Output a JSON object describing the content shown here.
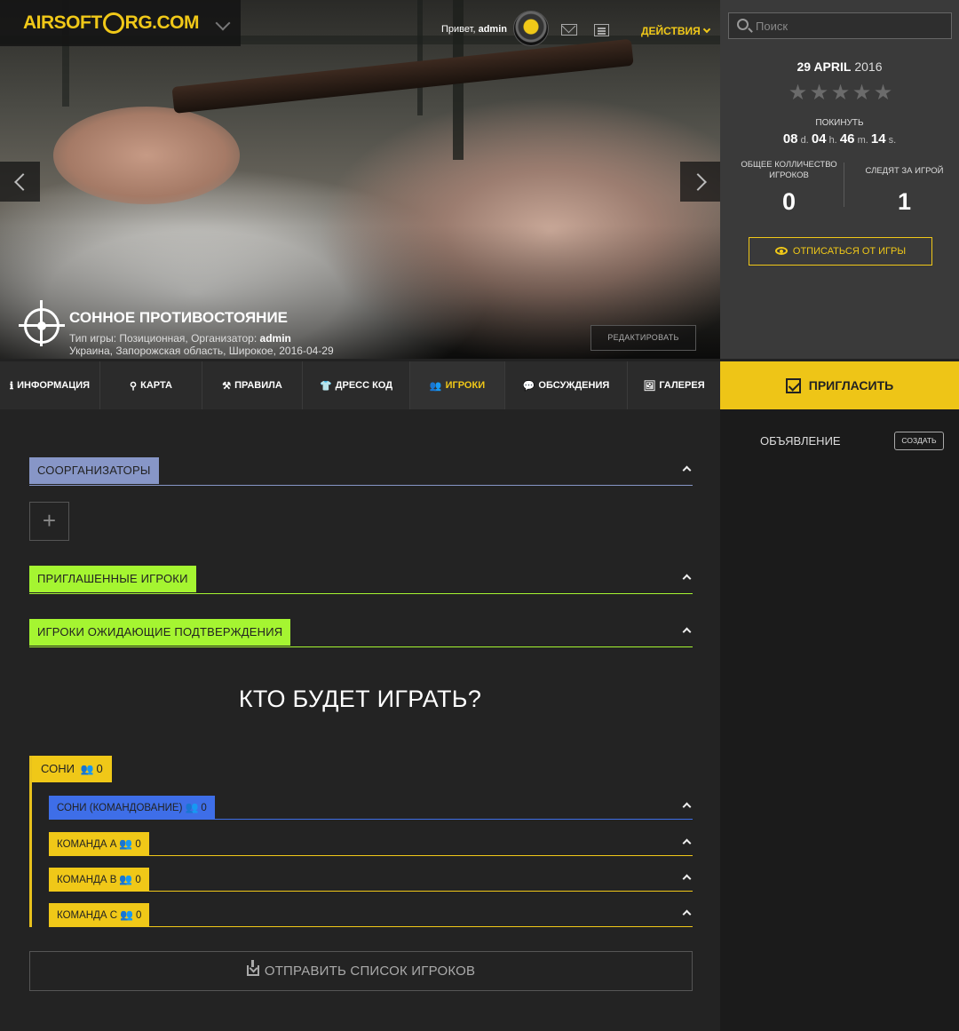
{
  "header": {
    "logo_text_left": "AIRSOFT",
    "logo_text_right": "RG.COM",
    "greeting_prefix": "Привет,",
    "username": "admin",
    "actions_label": "ДЕЙСТВИЯ"
  },
  "hero": {
    "title": "СОННОЕ ПРОТИВОСТОЯНИЕ",
    "meta_line1_prefix": "Тип игры: Позиционная, Организатор:",
    "organizer": "admin",
    "meta_line2": "Украина, Запорожская область, Широкое, 2016-04-29",
    "edit_label": "РЕДАКТИРОВАТЬ"
  },
  "side": {
    "search_placeholder": "Поиск",
    "date_bold": "29 APRIL",
    "date_year": "2016",
    "rating": 0,
    "rating_max": 5,
    "leave_label": "ПОКИНУТЬ",
    "countdown": {
      "d": "08",
      "d_unit": "d.",
      "h": "04",
      "h_unit": "h.",
      "m": "46",
      "m_unit": "m.",
      "s": "14",
      "s_unit": "s."
    },
    "total_players_label_1": "ОБЩЕЕ КОЛЛИЧЕСТВО",
    "total_players_label_2": "ИГРОКОВ",
    "total_players": "0",
    "followers_label": "СЛЕДЯТ ЗА ИГРОЙ",
    "followers": "1",
    "unsubscribe_label": "ОТПИСАТЬСЯ ОТ ИГРЫ"
  },
  "tabs": [
    {
      "icon": "ℹ",
      "label": "ИНФОРМАЦИЯ"
    },
    {
      "icon": "⚲",
      "label": "КАРТА"
    },
    {
      "icon": "⚒",
      "label": "ПРАВИЛА"
    },
    {
      "icon": "👕",
      "label": "ДРЕСС КОД"
    },
    {
      "icon": "👥",
      "label": "ИГРОКИ"
    },
    {
      "icon": "💬",
      "label": "ОБСУЖДЕНИЯ"
    },
    {
      "icon": "🖼",
      "label": "ГАЛЕРЕЯ"
    }
  ],
  "invite_label": "ПРИГЛАСИТЬ",
  "announcement": {
    "label": "ОБЪЯВЛЕНИЕ",
    "create_label": "СОЗДАТЬ"
  },
  "sections": {
    "coorganizers": "СООРГАНИЗАТОРЫ",
    "add_symbol": "+",
    "invited": "ПРИГЛАШЕННЫЕ ИГРОКИ",
    "pending": "ИГРОКИ ОЖИДАЮЩИЕ ПОДТВЕРЖДЕНИЯ"
  },
  "who_title": "КТО БУДЕТ ИГРАТЬ?",
  "team": {
    "name": "СОНИ",
    "count": "0",
    "subteams": [
      {
        "name": "СОНИ (КОМАНДОВАНИЕ)",
        "count": "0"
      },
      {
        "name": "КОМАНДА A",
        "count": "0"
      },
      {
        "name": "КОМАНДА B",
        "count": "0"
      },
      {
        "name": "КОМАНДА C",
        "count": "0"
      }
    ]
  },
  "send_list_label": "ОТПРАВИТЬ СПИСОК ИГРОКОВ",
  "colors": {
    "accent": "#f0c818",
    "coorg": "#8796c7",
    "invited": "#a5f531",
    "command": "#3e6ee8"
  }
}
